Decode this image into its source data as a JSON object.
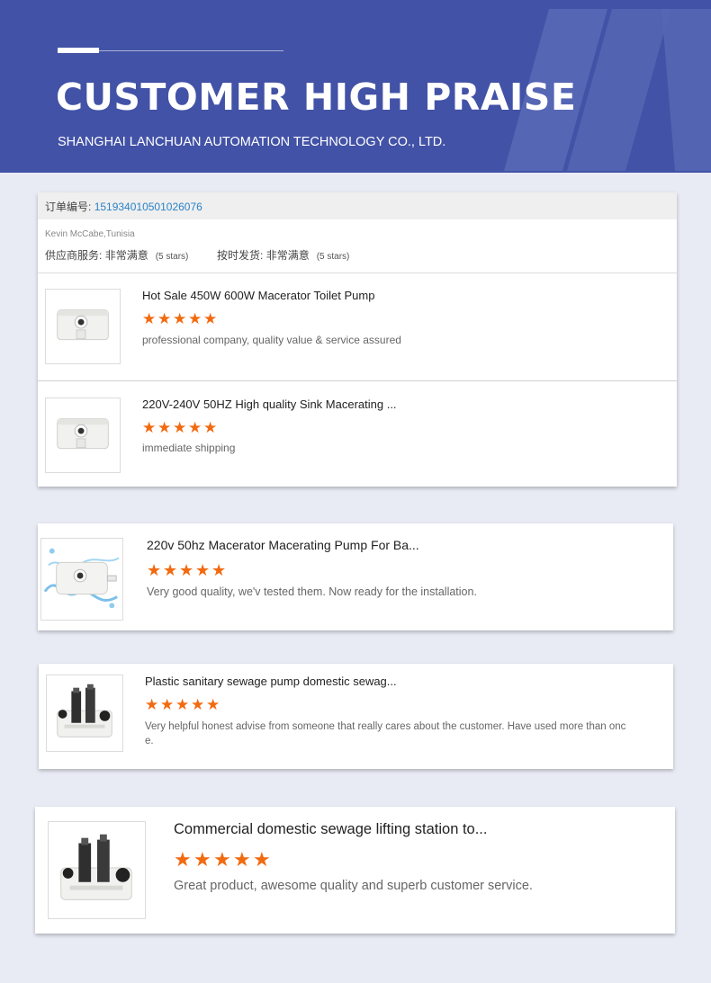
{
  "banner": {
    "title": "CUSTOMER HIGH PRAISE",
    "subtitle": "SHANGHAI LANCHUAN AUTOMATION TECHNOLOGY CO., LTD.",
    "background_color": "#4252a6"
  },
  "order": {
    "number_label": "订单编号:",
    "number": "151934010501026076",
    "buyer": "Kevin McCabe,Tunisia",
    "ratings": [
      {
        "label": "供应商服务:",
        "value": "非常满意",
        "stars": "(5 stars)"
      },
      {
        "label": "按时发货:",
        "value": "非常满意",
        "stars": "(5 stars)"
      }
    ],
    "items": [
      {
        "title": "Hot Sale 450W 600W Macerator Toilet Pump",
        "rating": 5,
        "review": "professional company, quality value & service assured",
        "image_icon": "macerator-pump-icon"
      },
      {
        "title": "220V-240V 50HZ High quality Sink Macerating ...",
        "rating": 5,
        "review": "immediate shipping",
        "image_icon": "macerator-pump-icon"
      }
    ]
  },
  "reviews": [
    {
      "title": "220v 50hz Macerator Macerating Pump For Ba...",
      "rating": 5,
      "review": "Very good quality, we'v tested them. Now ready for the installation.",
      "image_icon": "macerator-pump-splash-icon"
    },
    {
      "title": "Plastic sanitary sewage pump domestic sewag...",
      "rating": 5,
      "review_line1": "Very helpful honest advise from someone that really cares about the customer. Have used more than onc",
      "review_line2": "e.",
      "image_icon": "sewage-lifting-station-icon"
    },
    {
      "title": "Commercial domestic sewage lifting station to...",
      "rating": 5,
      "review": "Great product, awesome quality and superb customer service.",
      "image_icon": "sewage-lifting-station-icon"
    }
  ],
  "colors": {
    "star": "#f26a10",
    "order_number": "#2a82c6",
    "page_background": "#e8ebf4"
  }
}
